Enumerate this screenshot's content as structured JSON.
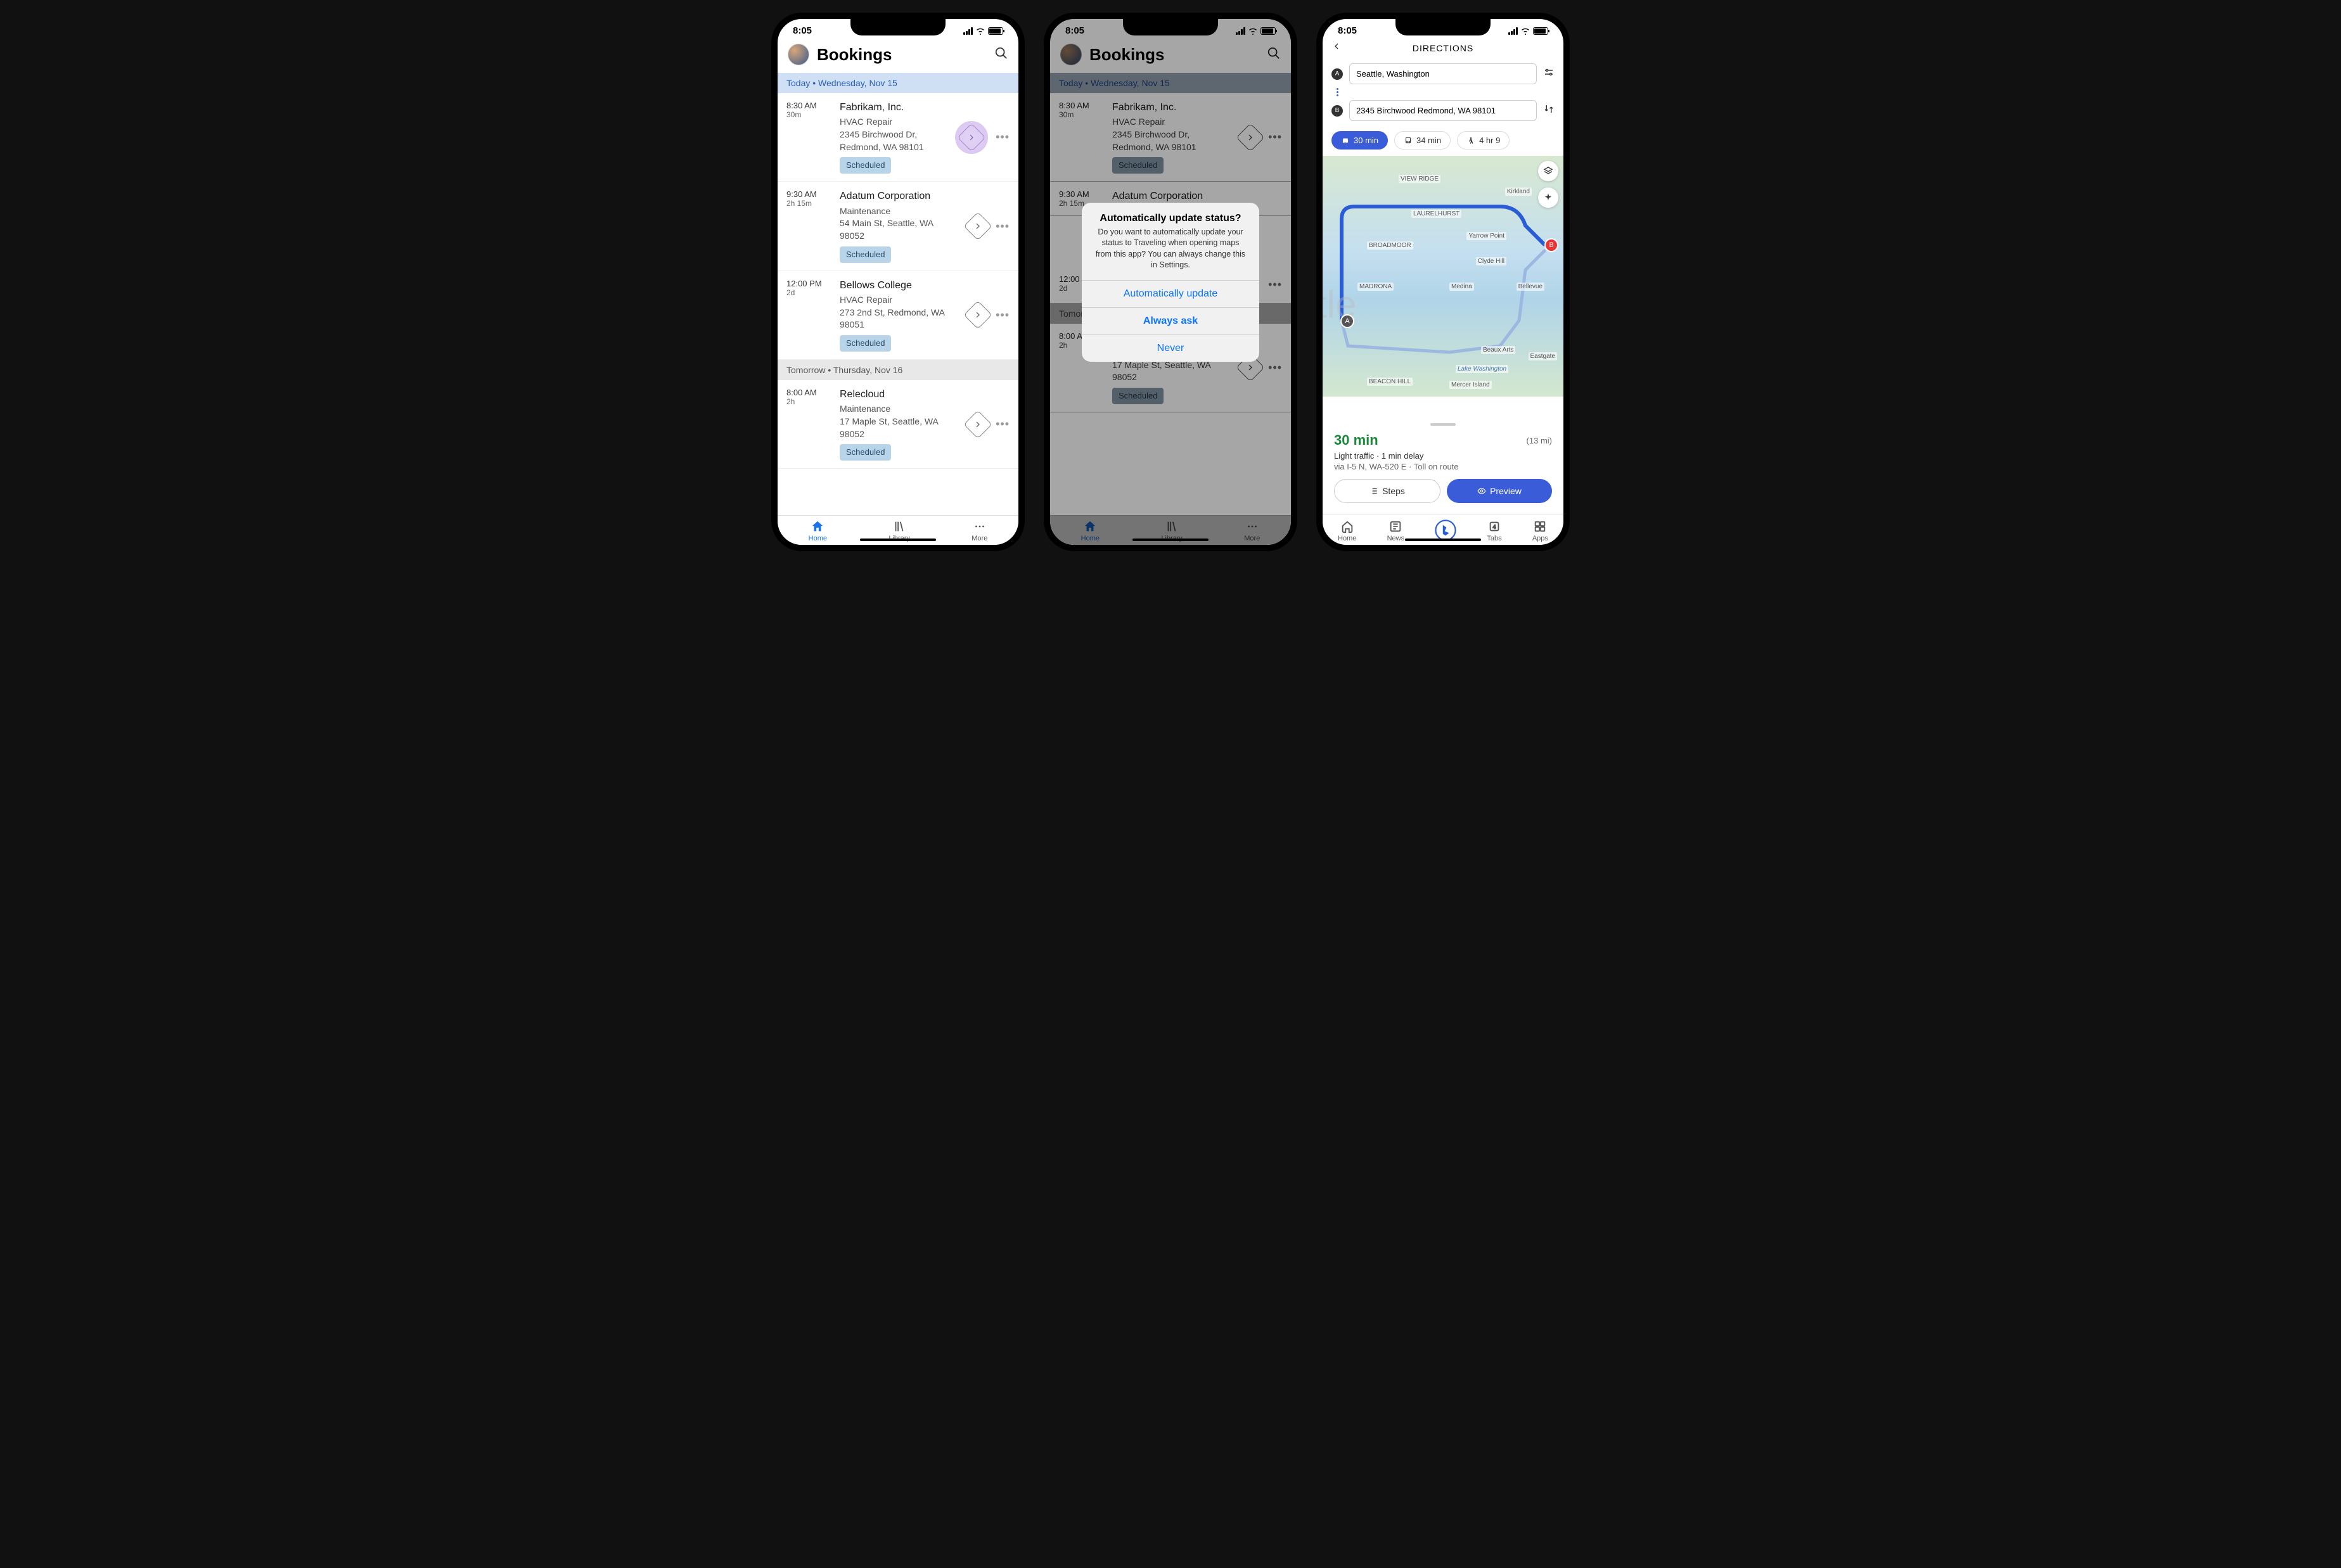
{
  "status_time": "8:05",
  "bookings": {
    "title": "Bookings",
    "today_header": "Today • Wednesday, Nov 15",
    "tomorrow_header": "Tomorrow • Thursday, Nov 16",
    "items": [
      {
        "time": "8:30 AM",
        "dur": "30m",
        "name": "Fabrikam, Inc.",
        "service": "HVAC Repair",
        "addr": "2345 Birchwood Dr, Redmond, WA 98101",
        "status": "Scheduled"
      },
      {
        "time": "9:30 AM",
        "dur": "2h 15m",
        "name": "Adatum Corporation",
        "service": "Maintenance",
        "addr": "54 Main St, Seattle, WA 98052",
        "status": "Scheduled"
      },
      {
        "time": "12:00 PM",
        "dur": "2d",
        "name": "Bellows College",
        "service": "HVAC Repair",
        "addr": "273 2nd St, Redmond, WA 98051",
        "status": "Scheduled"
      },
      {
        "time": "8:00 AM",
        "dur": "2h",
        "name": "Relecloud",
        "service": "Maintenance",
        "addr": "17 Maple St, Seattle, WA 98052",
        "status": "Scheduled"
      }
    ],
    "nav": {
      "home": "Home",
      "library": "Library",
      "more": "More"
    }
  },
  "dialog": {
    "title": "Automatically update status?",
    "body": "Do you want to automatically update your status to Traveling when opening maps from this app? You can always change this in Settings.",
    "opt1": "Automatically update",
    "opt2": "Always ask",
    "opt3": "Never"
  },
  "directions": {
    "title": "DIRECTIONS",
    "from": "Seattle, Washington",
    "to": "2345 Birchwood Redmond, WA 98101",
    "modes": {
      "drive": "30 min",
      "transit": "34 min",
      "walk": "4 hr 9"
    },
    "route_time": "30 min",
    "route_dist": "(13 mi)",
    "traffic": "Light traffic · 1 min delay",
    "via": "via I-5 N, WA-520 E · Toll on route",
    "steps_btn": "Steps",
    "preview_btn": "Preview",
    "nav": {
      "home": "Home",
      "news": "News",
      "tabs": "Tabs",
      "apps": "Apps"
    },
    "map_labels": [
      "VIEW RIDGE",
      "Kirkland",
      "LAURELHURST",
      "Yarrow Point",
      "Clyde Hill",
      "BROADMOOR",
      "MADRONA",
      "Medina",
      "Bellevue",
      "Beaux Arts",
      "Eastgate",
      "BEACON HILL",
      "Mercer Island",
      "Lake Washington"
    ]
  }
}
